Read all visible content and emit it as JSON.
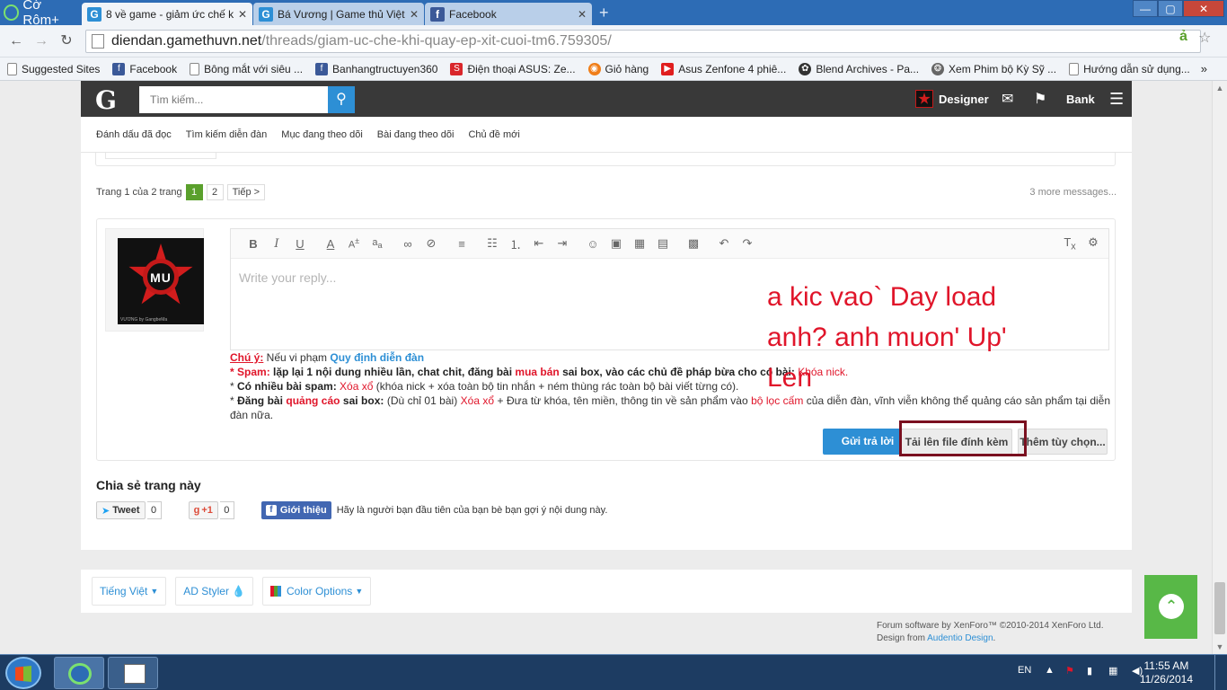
{
  "browser": {
    "brand": "Cờ Rôm+",
    "tabs": [
      {
        "title": "8 về game - giảm ức chế k",
        "favicon": "G"
      },
      {
        "title": "Bá Vương | Game thủ Việt",
        "favicon": "G"
      },
      {
        "title": "Facebook",
        "favicon": "f"
      }
    ],
    "new_tab_icon": "+",
    "url_host": "diendan.gamethuvn.net",
    "url_path": "/threads/giam-uc-che-khi-quay-ep-xit-cuoi-tm6.759305/",
    "bookmarks": [
      {
        "label": "Suggested Sites",
        "icon": "page"
      },
      {
        "label": "Facebook",
        "icon": "f"
      },
      {
        "label": "Bông mắt với siêu ...",
        "icon": "page"
      },
      {
        "label": "Banhangtructuyen360",
        "icon": "f"
      },
      {
        "label": "Điện thoại ASUS: Ze...",
        "icon": "S"
      },
      {
        "label": "Giỏ hàng",
        "icon": "cart"
      },
      {
        "label": "Asus Zenfone 4 phiê...",
        "icon": "yt"
      },
      {
        "label": "Blend Archives - Pa...",
        "icon": "blend"
      },
      {
        "label": "Xem Phim bộ Kỳ Sỹ ...",
        "icon": "film"
      },
      {
        "label": "Hướng dẫn sử dụng...",
        "icon": "page"
      }
    ],
    "bookmarks_more": "»"
  },
  "forum": {
    "logo": "G",
    "search_placeholder": "Tìm kiếm...",
    "user_name": "Designer",
    "bank_label": "Bank",
    "subnav": [
      "Đánh dấu đã đọc",
      "Tìm kiếm diễn đàn",
      "Mục đang theo dõi",
      "Bài đang theo dõi",
      "Chủ đề mới"
    ],
    "pagination": {
      "label": "Trang 1 của 2 trang",
      "current": "1",
      "next_page": "2",
      "next_label": "Tiếp >"
    },
    "more_messages": "3 more messages...",
    "avatar_text": "MU",
    "avatar_caption": "VƯƠNG by GangbeMa",
    "editor_placeholder": "Write your reply...",
    "rules": {
      "chu_y": "Chú ý:",
      "intro": " Nếu vi phạm ",
      "link": "Quy định diễn đàn",
      "r1_star": "* ",
      "r1_label": "Spam:",
      "r1_text_a": " lặp lại 1 nội dung nhiều lần, chat chit, đăng bài ",
      "r1_red": "mua bán",
      "r1_text_b": " sai box, vào các chủ đề pháp bừa cho có bài: ",
      "r1_penalty": "Khóa nick.",
      "r2_star": "* ",
      "r2_label": "Có nhiều bài spam:",
      "r2_red": " Xóa xổ",
      "r2_text": " (khóa nick + xóa toàn bộ tin nhắn + ném thùng rác toàn bộ bài viết từng có).",
      "r3_star": "* ",
      "r3_label_a": "Đăng bài ",
      "r3_red": "quảng cáo",
      "r3_label_b": " sai box:",
      "r3_text_a": " (Dù chỉ 01 bài) ",
      "r3_red2": "Xóa xổ",
      "r3_text_b": " + Đưa từ khóa, tên miền, thông tin về sản phẩm vào ",
      "r3_red3": "bộ lọc cấm",
      "r3_text_c": " của diễn đàn, vĩnh viễn không thể quảng cáo sản phẩm tại diễn đàn nữa."
    },
    "buttons": {
      "reply": "Gửi trả lời",
      "upload": "Tải lên file đính kèm",
      "more_options": "Thêm tùy chọn..."
    },
    "share": {
      "title": "Chia sẻ trang này",
      "tweet": "Tweet",
      "tweet_count": "0",
      "gplus": "+1",
      "gplus_count": "0",
      "fb_label": "Giới thiệu",
      "fb_text": "Hãy là người bạn đầu tiên của bạn bè bạn gợi ý nội dung này."
    },
    "lang_bar": {
      "language": "Tiếng Việt",
      "styler": "AD Styler",
      "color_options": "Color Options"
    },
    "footer": {
      "line1": "Forum software by XenForo™ ©2010-2014 XenForo Ltd.",
      "line2_prefix": "Design from ",
      "line2_link": "Audentio Design",
      "line2_suffix": "."
    }
  },
  "annotation": {
    "line1": "a kic vao` Day load",
    "line2": "anh? anh muon' Up'",
    "line3": "Len"
  },
  "taskbar": {
    "language": "EN",
    "time": "11:55 AM",
    "date": "11/26/2014"
  },
  "colors": {
    "accent": "#2d8fd5",
    "forum_bar": "#393939",
    "back_to_top": "#58b847",
    "annotation_red": "#e0152a",
    "highlight_box": "#7a1020"
  }
}
